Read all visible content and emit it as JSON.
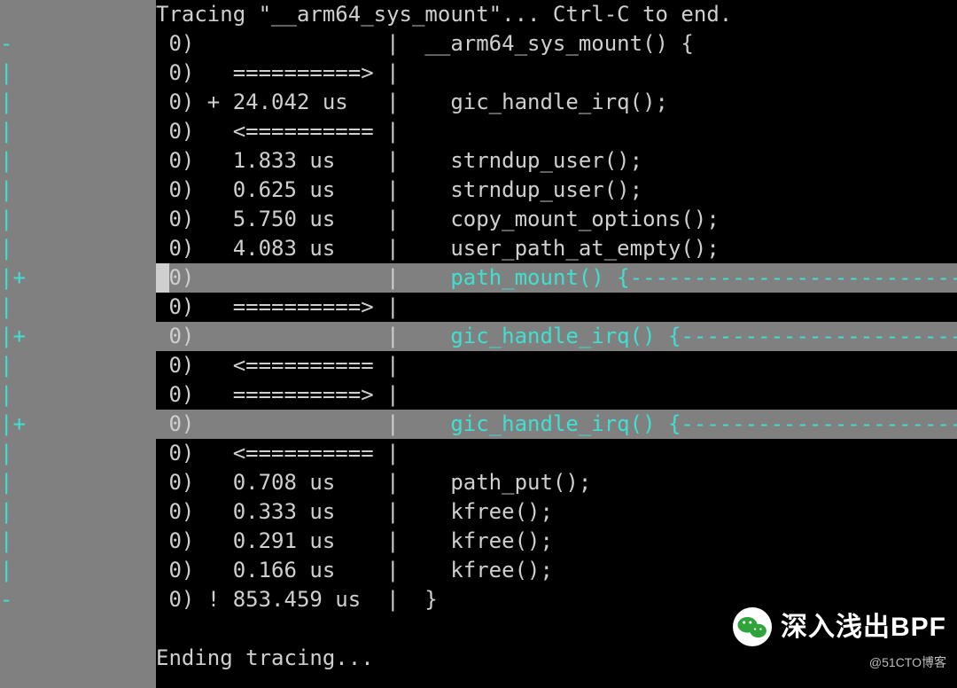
{
  "lines": [
    {
      "gutter": "",
      "body": "Tracing \"__arm64_sys_mount\"... Ctrl-C to end."
    },
    {
      "gutter": "-",
      "body": " 0)               |  __arm64_sys_mount() {"
    },
    {
      "gutter": "|",
      "body": " 0)   ==========> |"
    },
    {
      "gutter": "|",
      "body": " 0) + 24.042 us   |    gic_handle_irq();"
    },
    {
      "gutter": "|",
      "body": " 0)   <========== |"
    },
    {
      "gutter": "|",
      "body": " 0)   1.833 us    |    strndup_user();"
    },
    {
      "gutter": "|",
      "body": " 0)   0.625 us    |    strndup_user();"
    },
    {
      "gutter": "|",
      "body": " 0)   5.750 us    |    copy_mount_options();"
    },
    {
      "gutter": "|",
      "body": " 0)   4.083 us    |    user_path_at_empty();"
    },
    {
      "gutter": "|+",
      "body": " 0)               |    ",
      "tail": "path_mount() {----------------------------",
      "hl": true,
      "lead": true
    },
    {
      "gutter": "|",
      "body": " 0)   ==========> |"
    },
    {
      "gutter": "|+",
      "body": " 0)               |    ",
      "tail": "gic_handle_irq() {------------------------",
      "hl": true
    },
    {
      "gutter": "|",
      "body": " 0)   <========== |"
    },
    {
      "gutter": "|",
      "body": " 0)   ==========> |"
    },
    {
      "gutter": "|+",
      "body": " 0)               |    ",
      "tail": "gic_handle_irq() {------------------------",
      "hl": true
    },
    {
      "gutter": "|",
      "body": " 0)   <========== |"
    },
    {
      "gutter": "|",
      "body": " 0)   0.708 us    |    path_put();"
    },
    {
      "gutter": "|",
      "body": " 0)   0.333 us    |    kfree();"
    },
    {
      "gutter": "|",
      "body": " 0)   0.291 us    |    kfree();"
    },
    {
      "gutter": "|",
      "body": " 0)   0.166 us    |    kfree();"
    },
    {
      "gutter": "-",
      "body": " 0) ! 853.459 us  |  }"
    },
    {
      "gutter": "",
      "body": ""
    },
    {
      "gutter": "",
      "body": "Ending tracing..."
    }
  ],
  "watermark": {
    "title": "深入浅出BPF",
    "sub": "@51CTO博客"
  }
}
